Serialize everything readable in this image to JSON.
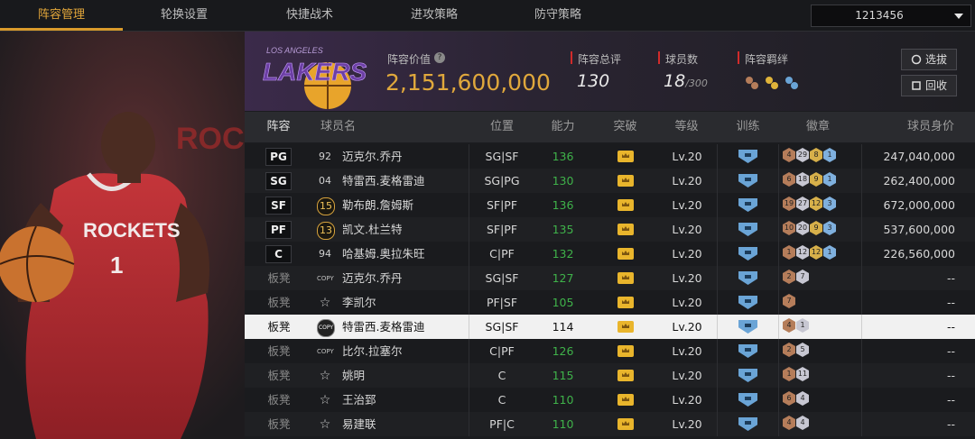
{
  "tabs": [
    "阵容管理",
    "轮换设置",
    "快捷战术",
    "进攻策略",
    "防守策略"
  ],
  "active_tab": 0,
  "account": {
    "value": "1213456"
  },
  "header": {
    "value_label": "阵容价值",
    "value": "2,151,600,000",
    "rating_label": "阵容总评",
    "rating": "130",
    "players_label": "球员数",
    "players": "18",
    "players_max": "/300",
    "bonds_label": "阵容羁绊",
    "btn_select": "选拔",
    "btn_recycle": "回收",
    "logo_text": "LAKERS",
    "logo_sub": "LOS ANGELES"
  },
  "player_art": {
    "team_text": "ROCKETS",
    "jersey_number": "1",
    "bg_text": "ROCK"
  },
  "columns": [
    "阵容",
    "球员名",
    "位置",
    "能力",
    "突破",
    "等级",
    "训练",
    "徽章",
    "球员身价"
  ],
  "rows": [
    {
      "slot": "PG",
      "num": "92",
      "num_type": "plain",
      "name": "迈克尔.乔丹",
      "pos": "SG|SF",
      "ability": "136",
      "level": "Lv.20",
      "badges": [
        [
          "b",
          "4"
        ],
        [
          "s",
          "29"
        ],
        [
          "g",
          "8"
        ],
        [
          "p",
          "1"
        ]
      ],
      "value": "247,040,000"
    },
    {
      "slot": "SG",
      "num": "04",
      "num_type": "plain",
      "name": "特雷西.麦格雷迪",
      "pos": "SG|PG",
      "ability": "130",
      "level": "Lv.20",
      "badges": [
        [
          "b",
          "6"
        ],
        [
          "s",
          "18"
        ],
        [
          "g",
          "9"
        ],
        [
          "p",
          "1"
        ]
      ],
      "value": "262,400,000"
    },
    {
      "slot": "SF",
      "num": "15",
      "num_type": "gold",
      "name": "勒布朗.詹姆斯",
      "pos": "SF|PF",
      "ability": "136",
      "level": "Lv.20",
      "badges": [
        [
          "b",
          "19"
        ],
        [
          "s",
          "27"
        ],
        [
          "g",
          "12"
        ],
        [
          "p",
          "3"
        ]
      ],
      "value": "672,000,000"
    },
    {
      "slot": "PF",
      "num": "13",
      "num_type": "gold",
      "name": "凯文.杜兰特",
      "pos": "SF|PF",
      "ability": "135",
      "level": "Lv.20",
      "badges": [
        [
          "b",
          "10"
        ],
        [
          "s",
          "20"
        ],
        [
          "g",
          "9"
        ],
        [
          "p",
          "3"
        ]
      ],
      "value": "537,600,000"
    },
    {
      "slot": "C",
      "num": "94",
      "num_type": "plain",
      "name": "哈基姆.奥拉朱旺",
      "pos": "C|PF",
      "ability": "132",
      "level": "Lv.20",
      "badges": [
        [
          "b",
          "1"
        ],
        [
          "s",
          "12"
        ],
        [
          "g",
          "12"
        ],
        [
          "p",
          "1"
        ]
      ],
      "value": "226,560,000"
    },
    {
      "slot": "板凳",
      "num": "COPY",
      "num_type": "copy",
      "name": "迈克尔.乔丹",
      "pos": "SG|SF",
      "ability": "127",
      "level": "Lv.20",
      "badges": [
        [
          "b",
          "2"
        ],
        [
          "s",
          "7"
        ]
      ],
      "value": "--"
    },
    {
      "slot": "板凳",
      "num": "☆",
      "num_type": "star",
      "name": "李凯尔",
      "pos": "PF|SF",
      "ability": "105",
      "level": "Lv.20",
      "badges": [
        [
          "b",
          "7"
        ]
      ],
      "value": "--"
    },
    {
      "slot": "板凳",
      "num": "COPY",
      "num_type": "seal",
      "name": "特雷西.麦格雷迪",
      "pos": "SG|SF",
      "ability": "114",
      "level": "Lv.20",
      "badges": [
        [
          "b",
          "4"
        ],
        [
          "s",
          "1"
        ]
      ],
      "value": "--"
    },
    {
      "slot": "板凳",
      "num": "COPY",
      "num_type": "copy",
      "name": "比尔.拉塞尔",
      "pos": "C|PF",
      "ability": "126",
      "level": "Lv.20",
      "badges": [
        [
          "b",
          "2"
        ],
        [
          "s",
          "5"
        ]
      ],
      "value": "--"
    },
    {
      "slot": "板凳",
      "num": "☆",
      "num_type": "star",
      "name": "姚明",
      "pos": "C",
      "ability": "115",
      "level": "Lv.20",
      "badges": [
        [
          "b",
          "1"
        ],
        [
          "s",
          "11"
        ]
      ],
      "value": "--"
    },
    {
      "slot": "板凳",
      "num": "☆",
      "num_type": "star",
      "name": "王治郅",
      "pos": "C",
      "ability": "110",
      "level": "Lv.20",
      "badges": [
        [
          "b",
          "6"
        ],
        [
          "s",
          "4"
        ]
      ],
      "value": "--"
    },
    {
      "slot": "板凳",
      "num": "☆",
      "num_type": "star",
      "name": "易建联",
      "pos": "PF|C",
      "ability": "110",
      "level": "Lv.20",
      "badges": [
        [
          "b",
          "4"
        ],
        [
          "s",
          "4"
        ]
      ],
      "value": "--"
    }
  ],
  "selected_row": 7,
  "colors": {
    "accent": "#e0a83c",
    "ability_green": "#3fb24a",
    "tab_active": "#e2a63a"
  }
}
